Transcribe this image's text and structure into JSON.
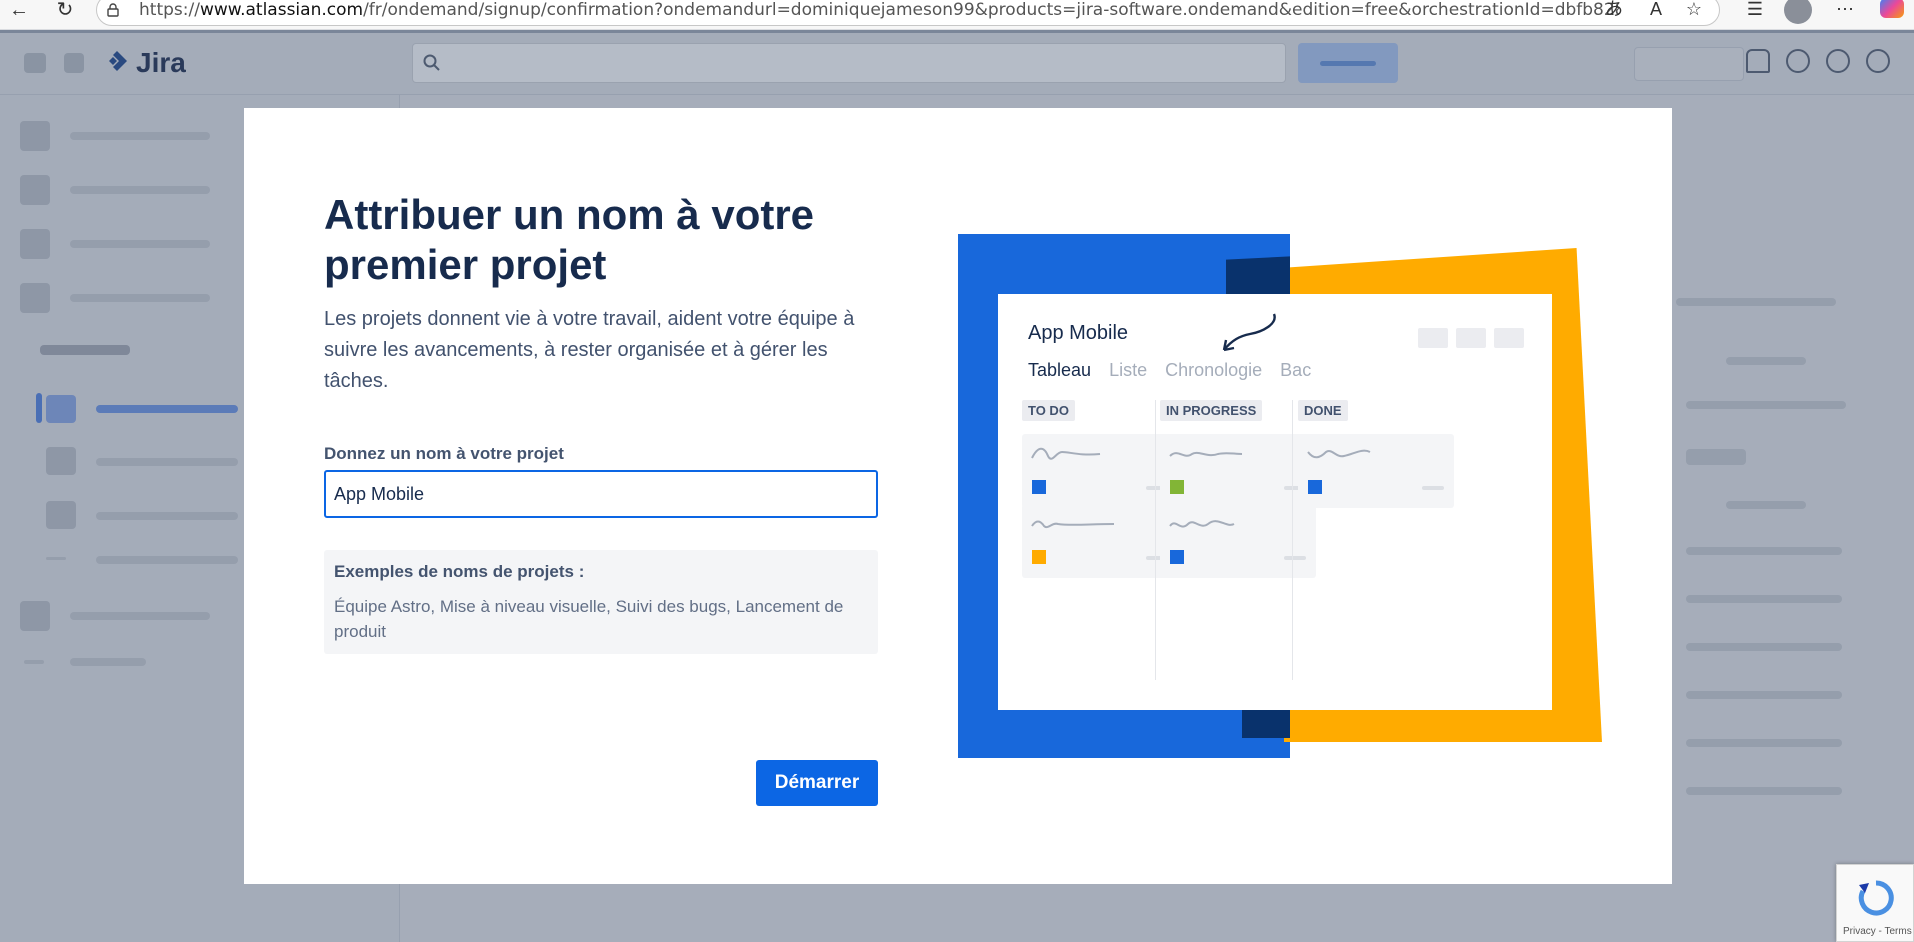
{
  "browser": {
    "url_prefix": "https://",
    "url_host": "www.atlassian.com",
    "url_path": "/fr/ondemand/signup/confirmation?ondemandurl=dominiquejameson99&products=jira-software.ondemand&edition=free&orchestrationId=dbfb8286-6cf8-4b..."
  },
  "app": {
    "name": "Jira"
  },
  "modal": {
    "title": "Attribuer un nom à votre premier projet",
    "description": "Les projets donnent vie à votre travail, aident votre équipe à suivre les avancements, à rester organisée et à gérer les tâches.",
    "field_label": "Donnez un nom à votre projet",
    "field_value": "App Mobile",
    "examples_title": "Exemples de noms de projets :",
    "examples_body": "Équipe Astro, Mise à niveau visuelle, Suivi des bugs, Lancement de produit",
    "start_button": "Démarrer"
  },
  "illustration": {
    "project_name": "App Mobile",
    "tabs": [
      "Tableau",
      "Liste",
      "Chronologie",
      "Bac"
    ],
    "columns": [
      "TO DO",
      "IN PROGRESS",
      "DONE"
    ],
    "colors": {
      "blue": "#1868db",
      "orange": "#ffab00",
      "green": "#82b536"
    }
  },
  "recaptcha": {
    "text": "Privacy - Terms"
  }
}
